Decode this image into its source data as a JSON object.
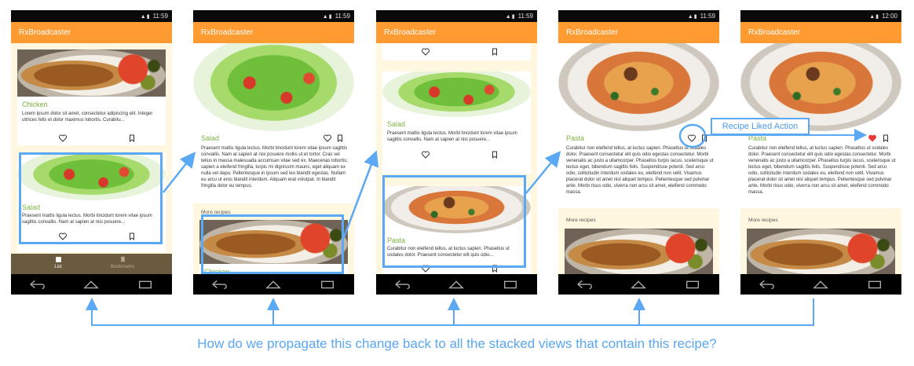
{
  "app_title": "RxBroadcaster",
  "status_times": [
    "11:59",
    "11:59",
    "11:59",
    "11:59",
    "12:00"
  ],
  "recipes": {
    "chicken": {
      "title": "Chicken",
      "body": "Lorem ipsum dolor sit amet, consectetur adipiscing elit. Integer ultrices felis et dolor maximus lobortis. Curabitu..."
    },
    "salad": {
      "title": "Salad",
      "body_short": "Praesent mattis ligula lectus. Morbi tincidunt lorem vitae ipsum sagittis convallis. Nam at sapien at nisi posuere...",
      "body_full": "Praesent mattis ligula lectus. Morbi tincidunt lorem vitae ipsum sagittis convallis. Nam at sapien at nisi posuere mollis ut et tortor. Cras vel tellus in massa malesuada accumsan vitae sed ex. Maecenas lobortis, sapien a eleifend fringilla, turpis mi dignissim mauris, eget aliquam ex nulla vel dapu. Pellentesque in ipsum sed leo blandit egestas. Nullam eu arcu ut eros blandit interdum. Aliquam erat volutpat. In blandit fringilla dolor eu tempus."
    },
    "pasta": {
      "title": "Pasta",
      "body_short": "Curabitur non eleifend tellus, at luctus sapien. Phasellus ut sodales dolor. Praesent consectetur elit quis odio...",
      "body_full": "Curabitur non eleifend tellus, at luctus sapien. Phasellus ut sodales dolor. Praesent consectetur elit quis odio egestas consectetur. Morbi venenatis ac justo a ullamcorper. Phasellus turpis lacus, scelerisque ut lectus eget, bibendum sagittis felis. Suspendisse potenti. Sed arcu odio, sollicitudin interdum sodales eu, eleifend non velit. Vivamus placerat dolor sit amet nisl aliquet tempus. Pellentesque sed pulvinar ante. Morbi risus odio, viverra non arcu sit amet, eleifend commodo massa."
    }
  },
  "more_recipes": "More recipes",
  "tabs": {
    "list": "List",
    "bookmarks": "Bookmarks"
  },
  "callout": "Recipe Liked Action",
  "caption": "How do we propagate this change back to all the stacked views that contain this recipe?",
  "colors": {
    "appbar": "#FF9B30",
    "accent_blue": "#5BA8F5",
    "title_green": "#7CB342",
    "liked_heart": "#E53935"
  }
}
